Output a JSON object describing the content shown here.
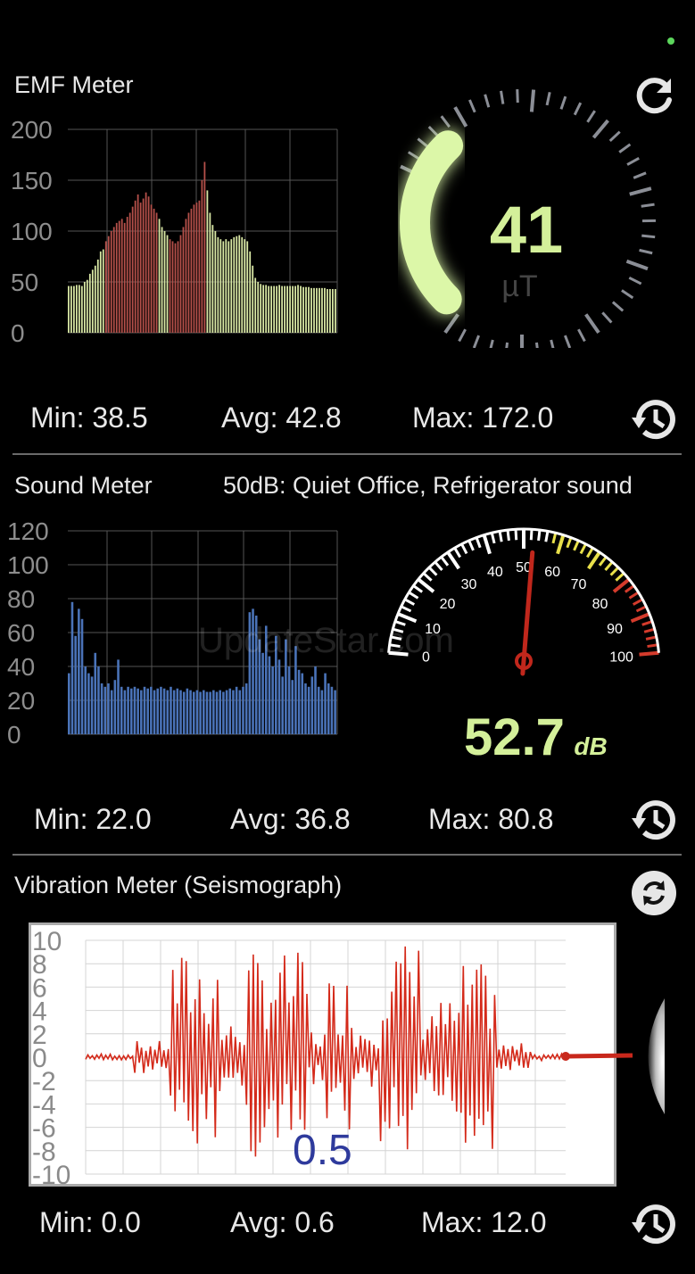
{
  "status_dot_color": "#5cd65c",
  "emf": {
    "title": "EMF Meter",
    "gauge_value": "41",
    "unit": "µT",
    "min_label": "Min: 38.5",
    "avg_label": "Avg: 42.8",
    "max_label": "Max: 172.0",
    "y_ticks": [
      "200",
      "150",
      "100",
      "50",
      "0"
    ],
    "accent_color": "#d4f09a",
    "refresh_icon": "refresh-icon",
    "history_icon": "history-icon"
  },
  "sound": {
    "title": "Sound Meter",
    "description": "50dB: Quiet Office, Refrigerator sound",
    "value": "52.7",
    "unit": "dB",
    "min_label": "Min: 22.0",
    "avg_label": "Avg: 36.8",
    "max_label": "Max: 80.8",
    "y_ticks": [
      "120",
      "100",
      "80",
      "60",
      "40",
      "20",
      "0"
    ],
    "dial_labels": [
      "0",
      "10",
      "20",
      "30",
      "40",
      "50",
      "60",
      "70",
      "80",
      "90",
      "100"
    ],
    "needle_value": 52.7,
    "history_icon": "history-icon"
  },
  "vibration": {
    "title": "Vibration Meter (Seismograph)",
    "current_value": "0.5",
    "min_label": "Min: 0.0",
    "avg_label": "Avg: 0.6",
    "max_label": "Max: 12.0",
    "y_ticks": [
      "10",
      "8",
      "6",
      "4",
      "2",
      "0",
      "-2",
      "-4",
      "-6",
      "-8",
      "-10"
    ],
    "sync_icon": "sync-icon",
    "history_icon": "history-icon"
  },
  "watermark": "UpdateStar.com"
}
